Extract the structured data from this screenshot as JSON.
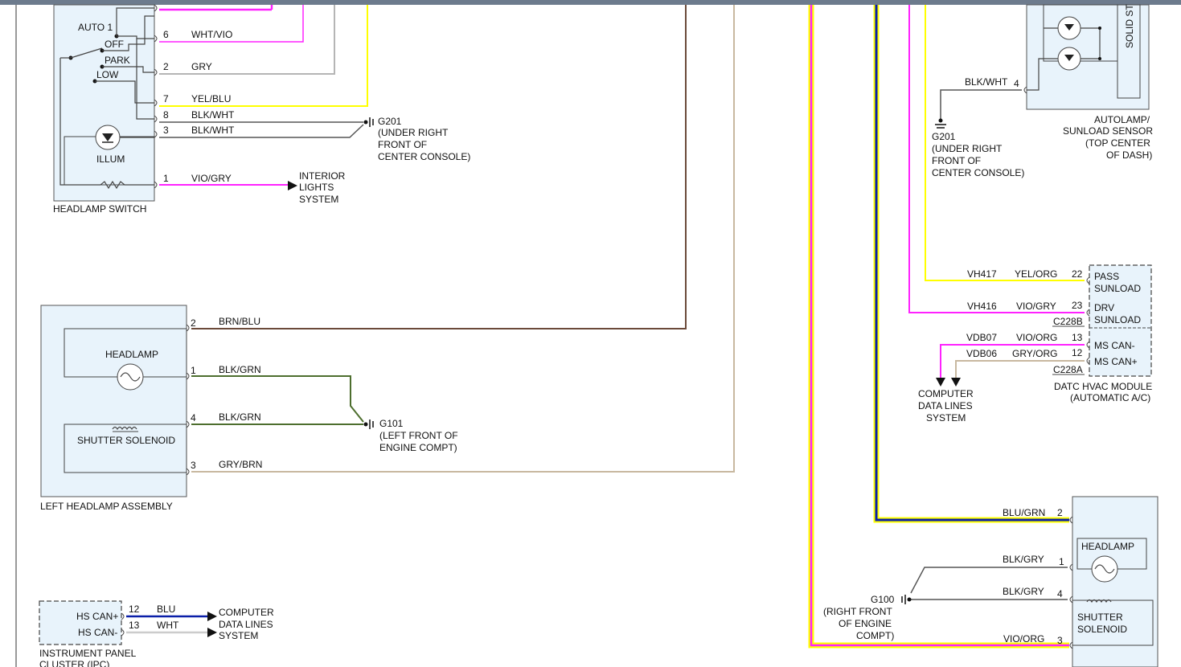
{
  "headlamp_switch": {
    "name": "HEADLAMP SWITCH",
    "positions": [
      "AUTO 1",
      "OFF",
      "PARK",
      "LOW"
    ],
    "illum_label": "ILLUM",
    "pins": [
      {
        "pin": "6",
        "wire": "WHT/VIO"
      },
      {
        "pin": "2",
        "wire": "GRY"
      },
      {
        "pin": "7",
        "wire": "YEL/BLU"
      },
      {
        "pin": "8",
        "wire": "BLK/WHT"
      },
      {
        "pin": "3",
        "wire": "BLK/WHT"
      },
      {
        "pin": "1",
        "wire": "VIO/GRY"
      }
    ],
    "interior_lights": [
      "INTERIOR",
      "LIGHTS",
      "SYSTEM"
    ]
  },
  "g201_left": {
    "id": "G201",
    "lines": [
      "(UNDER RIGHT",
      "FRONT OF",
      "CENTER CONSOLE)"
    ]
  },
  "left_headlamp": {
    "name": "LEFT HEADLAMP ASSEMBLY",
    "headlamp_label": "HEADLAMP",
    "shutter_label": "SHUTTER SOLENOID",
    "pins": [
      {
        "pin": "2",
        "wire": "BRN/BLU"
      },
      {
        "pin": "1",
        "wire": "BLK/GRN"
      },
      {
        "pin": "4",
        "wire": "BLK/GRN"
      },
      {
        "pin": "3",
        "wire": "GRY/BRN"
      }
    ]
  },
  "g101": {
    "id": "G101",
    "lines": [
      "(LEFT FRONT OF",
      "ENGINE COMPT)"
    ]
  },
  "ipc": {
    "name": "INSTRUMENT PANEL",
    "name2": "CLUSTER (IPC)",
    "pins": [
      {
        "pin": "12",
        "wire": "BLU",
        "label": "HS CAN+"
      },
      {
        "pin": "13",
        "wire": "WHT",
        "label": "HS CAN-"
      }
    ],
    "dest": [
      "COMPUTER",
      "DATA LINES",
      "SYSTEM"
    ]
  },
  "autolamp": {
    "side_label": "SOLID ST",
    "pin": "4",
    "wire": "BLK/WHT",
    "name_lines": [
      "AUTOLAMP/",
      "SUNLOAD SENSOR",
      "(TOP CENTER",
      "OF DASH)"
    ]
  },
  "g201_right": {
    "id": "G201",
    "lines": [
      "(UNDER RIGHT",
      "FRONT OF",
      "CENTER CONSOLE)"
    ]
  },
  "datc": {
    "name_lines": [
      "DATC HVAC MODULE",
      "(AUTOMATIC A/C)"
    ],
    "rows": [
      {
        "circuit": "VH417",
        "wire": "YEL/ORG",
        "pin": "22",
        "label": "PASS",
        "label2": "SUNLOAD"
      },
      {
        "circuit": "VH416",
        "wire": "VIO/GRY",
        "pin": "23",
        "label": "DRV",
        "label2": "SUNLOAD"
      },
      {
        "circuit": "VDB07",
        "wire": "VIO/ORG",
        "pin": "13",
        "label": "MS CAN-"
      },
      {
        "circuit": "VDB06",
        "wire": "GRY/ORG",
        "pin": "12",
        "label": "MS CAN+"
      }
    ],
    "connector_b": "C228B",
    "connector_a": "C228A",
    "dest": [
      "COMPUTER",
      "DATA LINES",
      "SYSTEM"
    ]
  },
  "right_headlamp": {
    "headlamp_label": "HEADLAMP",
    "shutter_label": "SHUTTER",
    "shutter_label2": "SOLENOID",
    "pins": [
      {
        "pin": "2",
        "wire": "BLU/GRN"
      },
      {
        "pin": "1",
        "wire": "BLK/GRY"
      },
      {
        "pin": "4",
        "wire": "BLK/GRY"
      },
      {
        "pin": "3",
        "wire": "VIO/ORG"
      }
    ]
  },
  "g100": {
    "id": "G100",
    "lines": [
      "(RIGHT FRONT",
      "OF ENGINE",
      "COMPT)"
    ]
  },
  "colors": {
    "yellow": "#ffff00",
    "magenta": "#ff22ff",
    "blue": "#0a1fa8",
    "gray": "#b5b5b5",
    "tan": "#c8b8a0",
    "brown": "#6b4a3a",
    "green": "#4d6e2e",
    "dark": "#555555"
  }
}
